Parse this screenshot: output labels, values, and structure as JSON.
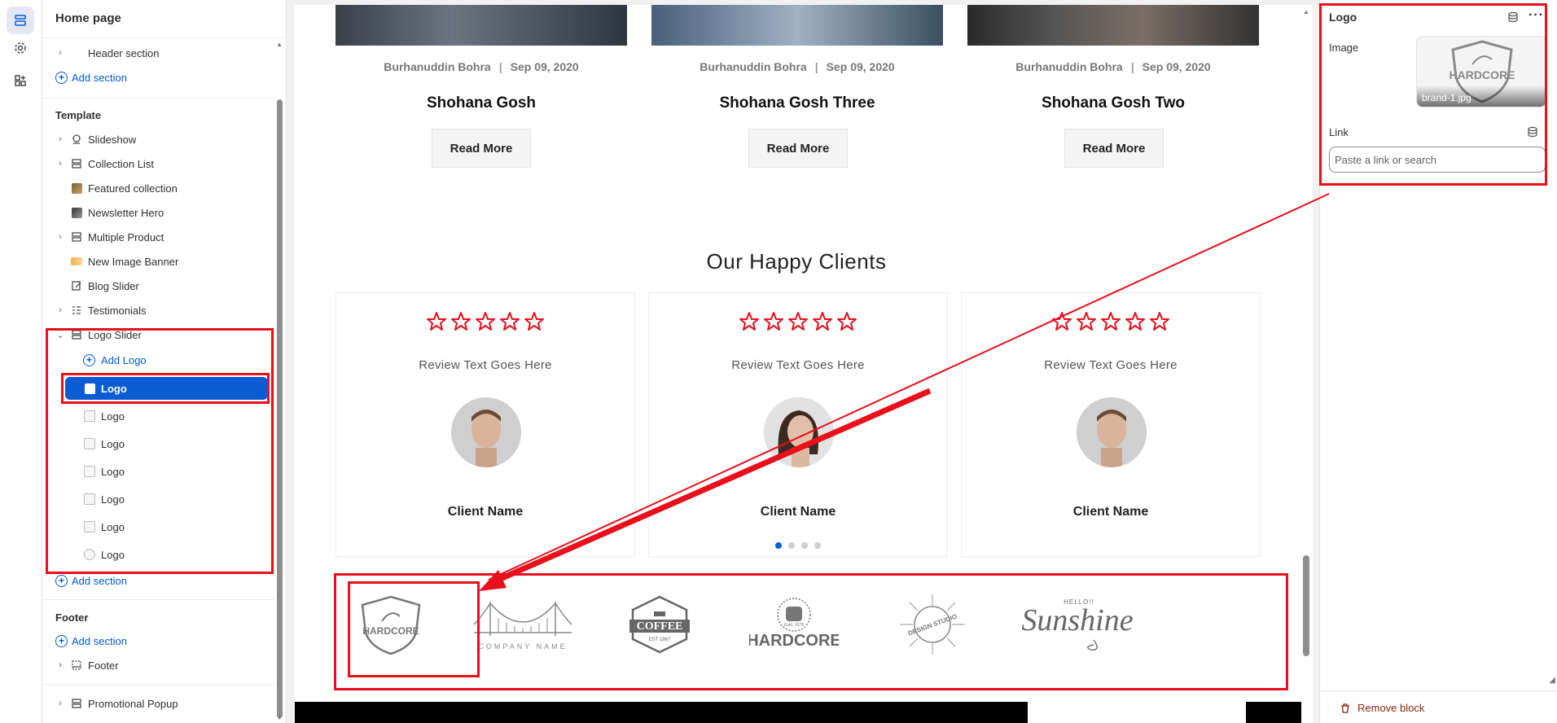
{
  "sidebar": {
    "title": "Home page",
    "header_section": "Header section",
    "add_section": "Add section",
    "template_label": "Template",
    "template_items": [
      {
        "label": "Slideshow"
      },
      {
        "label": "Collection List"
      },
      {
        "label": "Featured collection"
      },
      {
        "label": "Newsletter Hero"
      },
      {
        "label": "Multiple Product"
      },
      {
        "label": "New Image Banner"
      },
      {
        "label": "Blog Slider"
      },
      {
        "label": "Testimonials"
      },
      {
        "label": "Logo Slider"
      }
    ],
    "add_logo": "Add Logo",
    "logo_items": [
      "Logo",
      "Logo",
      "Logo",
      "Logo",
      "Logo",
      "Logo",
      "Logo"
    ],
    "footer_label": "Footer",
    "footer_item": "Footer",
    "promotional": "Promotional Popup"
  },
  "preview": {
    "posts": [
      {
        "author": "Burhanuddin Bohra",
        "date": "Sep 09, 2020",
        "title": "Shohana Gosh",
        "button": "Read More"
      },
      {
        "author": "Burhanuddin Bohra",
        "date": "Sep 09, 2020",
        "title": "Shohana Gosh Three",
        "button": "Read More"
      },
      {
        "author": "Burhanuddin Bohra",
        "date": "Sep 09, 2020",
        "title": "Shohana Gosh Two",
        "button": "Read More"
      }
    ],
    "meta_separator": "|",
    "clients_title": "Our Happy Clients",
    "testimonials": [
      {
        "review": "Review Text Goes Here",
        "name": "Client Name",
        "rating": 0
      },
      {
        "review": "Review Text Goes Here",
        "name": "Client Name",
        "rating": 0
      },
      {
        "review": "Review Text Goes Here",
        "name": "Client Name",
        "rating": 0
      }
    ],
    "dots_active_index": 0,
    "logos": {
      "hardcore_1": "HARDCORE",
      "company": "COMPANY NAME",
      "coffee": "COFFEE",
      "coffee_est": "EST 1967",
      "hardcore_2": "HARDCORE",
      "hardcore_2_small": "Estd.          1978",
      "design": "DESIGN STUDIO",
      "sunshine_small": "HELLO!!",
      "sunshine": "Sunshine"
    }
  },
  "panel": {
    "title": "Logo",
    "image_label": "Image",
    "image_caption": "brand-1.jpg",
    "image_logo_text": "HARDCORE",
    "link_label": "Link",
    "link_placeholder": "Paste a link or search",
    "remove_label": "Remove block"
  },
  "colors": {
    "accent": "#0b5bd3",
    "annotation": "#e8101a",
    "star": "#e8101a",
    "danger": "#8e1f0b"
  }
}
